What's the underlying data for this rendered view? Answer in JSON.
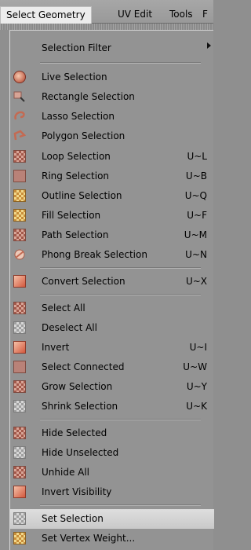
{
  "menubar": {
    "items": [
      {
        "label": "Select Geometry",
        "active": true
      },
      {
        "label": "UV Edit",
        "active": false
      },
      {
        "label": "Tools",
        "active": false
      },
      {
        "label": "F",
        "active": false
      }
    ]
  },
  "dropdown": {
    "selection_filter": {
      "label": "Selection Filter",
      "icon": "none",
      "has_submenu": true
    },
    "group1": [
      {
        "label": "Live Selection",
        "shortcut": "",
        "icon": "live-selection-icon"
      },
      {
        "label": "Rectangle Selection",
        "shortcut": "",
        "icon": "rectangle-selection-icon"
      },
      {
        "label": "Lasso Selection",
        "shortcut": "",
        "icon": "lasso-selection-icon"
      },
      {
        "label": "Polygon Selection",
        "shortcut": "",
        "icon": "polygon-selection-icon"
      }
    ],
    "group2": [
      {
        "label": "Loop Selection",
        "shortcut": "U~L",
        "icon": "loop-selection-icon"
      },
      {
        "label": "Ring Selection",
        "shortcut": "U~B",
        "icon": "ring-selection-icon"
      },
      {
        "label": "Outline Selection",
        "shortcut": "U~Q",
        "icon": "outline-selection-icon"
      },
      {
        "label": "Fill Selection",
        "shortcut": "U~F",
        "icon": "fill-selection-icon"
      },
      {
        "label": "Path Selection",
        "shortcut": "U~M",
        "icon": "path-selection-icon"
      },
      {
        "label": "Phong Break Selection",
        "shortcut": "U~N",
        "icon": "phong-break-icon"
      }
    ],
    "group3": [
      {
        "label": "Convert Selection",
        "shortcut": "U~X",
        "icon": "convert-selection-icon"
      }
    ],
    "group4": [
      {
        "label": "Select All",
        "shortcut": "",
        "icon": "select-all-icon"
      },
      {
        "label": "Deselect All",
        "shortcut": "",
        "icon": "deselect-all-icon"
      },
      {
        "label": "Invert",
        "shortcut": "U~I",
        "icon": "invert-icon"
      },
      {
        "label": "Select Connected",
        "shortcut": "U~W",
        "icon": "select-connected-icon"
      },
      {
        "label": "Grow Selection",
        "shortcut": "U~Y",
        "icon": "grow-selection-icon"
      },
      {
        "label": "Shrink Selection",
        "shortcut": "U~K",
        "icon": "shrink-selection-icon"
      }
    ],
    "group5": [
      {
        "label": "Hide Selected",
        "shortcut": "",
        "icon": "hide-selected-icon"
      },
      {
        "label": "Hide Unselected",
        "shortcut": "",
        "icon": "hide-unselected-icon"
      },
      {
        "label": "Unhide All",
        "shortcut": "",
        "icon": "unhide-all-icon"
      },
      {
        "label": "Invert Visibility",
        "shortcut": "",
        "icon": "invert-visibility-icon"
      }
    ],
    "group6": [
      {
        "label": "Set Selection",
        "shortcut": "",
        "icon": "set-selection-icon",
        "highlighted": true
      },
      {
        "label": "Set Vertex Weight...",
        "shortcut": "",
        "icon": "set-vertex-weight-icon"
      }
    ]
  },
  "colors": {
    "menu_bg": "#939393",
    "highlight": "#d6d6d6",
    "icon_red": "#c46a52"
  }
}
